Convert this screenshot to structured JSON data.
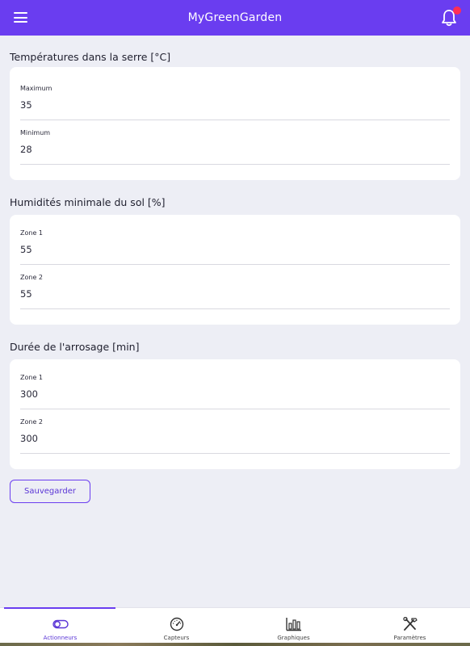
{
  "header": {
    "title": "MyGreenGarden",
    "accent_color": "#6a3df0",
    "notification_dot_color": "#ff2d55"
  },
  "sections": [
    {
      "title": "Températures dans la serre [°C]",
      "fields": [
        {
          "label": "Maximum",
          "value": "35"
        },
        {
          "label": "Minimum",
          "value": "28"
        }
      ]
    },
    {
      "title": "Humidités minimale du sol [%]",
      "fields": [
        {
          "label": "Zone 1",
          "value": "55"
        },
        {
          "label": "Zone 2",
          "value": "55"
        }
      ]
    },
    {
      "title": "Durée de l'arrosage [min]",
      "fields": [
        {
          "label": "Zone 1",
          "value": "300"
        },
        {
          "label": "Zone 2",
          "value": "300"
        }
      ]
    }
  ],
  "save_label": "Sauvegarder",
  "nav": {
    "items": [
      {
        "label": "Actionneurs",
        "icon": "toggle-icon",
        "active": true
      },
      {
        "label": "Capteurs",
        "icon": "gauge-icon",
        "active": false
      },
      {
        "label": "Graphiques",
        "icon": "bar-chart-icon",
        "active": false
      },
      {
        "label": "Paramètres",
        "icon": "tools-icon",
        "active": false
      }
    ]
  }
}
